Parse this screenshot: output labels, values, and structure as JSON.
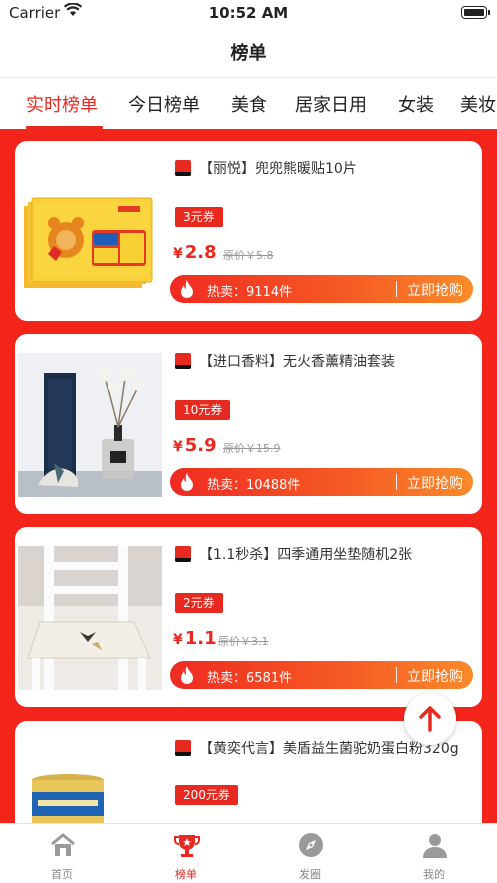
{
  "status_bar": {
    "carrier": "Carrier",
    "time": "10:52 AM"
  },
  "nav": {
    "title": "榜单"
  },
  "tabs": [
    {
      "label": "实时榜单",
      "active": true
    },
    {
      "label": "今日榜单"
    },
    {
      "label": "美食"
    },
    {
      "label": "居家日用"
    },
    {
      "label": "女装"
    },
    {
      "label": "美妆"
    }
  ],
  "products": [
    {
      "title": "【丽悦】兜兜熊暖贴10片",
      "coupon": "3元券",
      "currency": "¥",
      "price": "2.8",
      "original_price": "原价￥5.8",
      "hot": "热卖：9114件",
      "buy": "立即抢购"
    },
    {
      "title": "【进口香料】无火香薰精油套装",
      "coupon": "10元券",
      "currency": "¥",
      "price": "5.9",
      "original_price": "原价￥15.9",
      "hot": "热卖：10488件",
      "buy": "立即抢购"
    },
    {
      "title": "【1.1秒杀】四季通用坐垫随机2张",
      "coupon": "2元券",
      "currency": "¥",
      "price": "1.1",
      "original_price": "原价￥3.1",
      "hot": "热卖：6581件",
      "buy": "立即抢购"
    },
    {
      "title": "【黄奕代言】美盾益生菌驼奶蛋白粉320g",
      "coupon": "200元券"
    }
  ],
  "tab_bar": [
    {
      "label": "首页",
      "icon": "home-icon"
    },
    {
      "label": "榜单",
      "icon": "trophy-icon",
      "active": true
    },
    {
      "label": "发圈",
      "icon": "compass-icon"
    },
    {
      "label": "我的",
      "icon": "user-icon"
    }
  ],
  "colors": {
    "accent": "#e8291f",
    "background_red": "#f3251b",
    "hot_gradient_end": "#fa8b2a"
  }
}
